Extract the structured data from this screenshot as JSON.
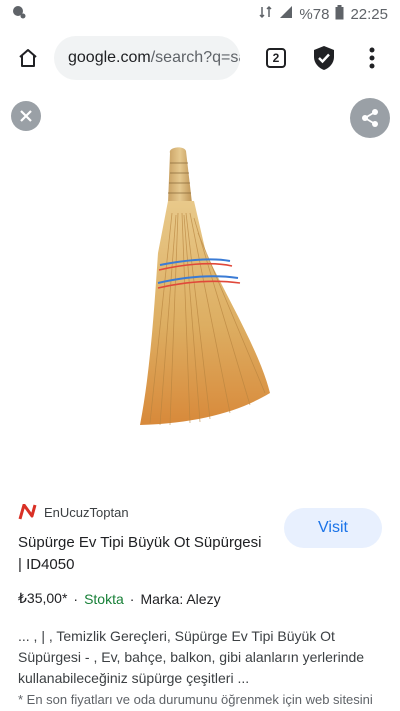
{
  "status_bar": {
    "battery": "%78",
    "time": "22:25"
  },
  "toolbar": {
    "url_domain": "google.com",
    "url_path": "/search?q=sa",
    "tab_count": "2"
  },
  "result": {
    "source": "EnUcuzToptan",
    "visit_label": "Visit",
    "title": "Süpürge Ev Tipi Büyük Ot Süpürgesi | ID4050",
    "price": "₺35,00*",
    "separator": "·",
    "stock": "Stokta",
    "brand": "Marka: Alezy",
    "description": "... , | , Temizlik Gereçleri, Süpürge Ev Tipi Büyük Ot Süpürgesi - , Ev, bahçe, balkon, gibi alanların yerlerinde kullanabileceğiniz süpürge çeşitleri ...",
    "footnote": "* En son fiyatları ve oda durumunu öğrenmek için web sitesini"
  },
  "colors": {
    "accent": "#1a73e8",
    "stock": "#188038",
    "logo": "#d93025"
  },
  "icons": [
    "home-icon",
    "shield-check-icon",
    "more-vert-icon",
    "close-icon",
    "share-icon",
    "signal-icon",
    "battery-icon"
  ]
}
